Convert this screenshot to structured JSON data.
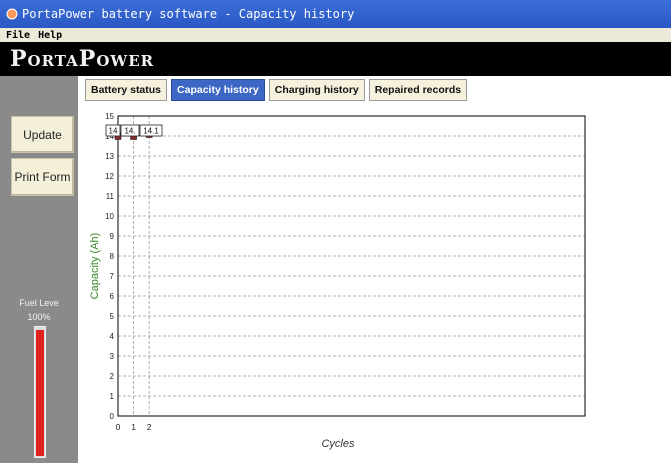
{
  "window": {
    "title": "PortaPower battery software - Capacity history"
  },
  "menu": [
    {
      "label": "File"
    },
    {
      "label": "Help"
    }
  ],
  "brand": {
    "logo_text": "PortaPower"
  },
  "sidebar": {
    "buttons": [
      {
        "label": "Update"
      },
      {
        "label": "Print Form"
      }
    ],
    "fuel_label": "Fuel Leve",
    "fuel_percent_label": "100%",
    "fuel_level": 1.0,
    "fuel_color": "#e2221e"
  },
  "tabs": [
    {
      "label": "Battery status",
      "active": false
    },
    {
      "label": "Capacity history",
      "active": true
    },
    {
      "label": "Charging history",
      "active": false
    },
    {
      "label": "Repaired records",
      "active": false
    }
  ],
  "colors": {
    "accent": "#3d67c4",
    "axis_label": "#3a8a2a",
    "marker": "#8b2a2a"
  },
  "chart_data": {
    "type": "line",
    "x": [
      0,
      1,
      2
    ],
    "y": [
      14,
      14,
      14.1
    ],
    "data_labels": [
      "14",
      "14.",
      "14.1"
    ],
    "xlabel": "Cycles",
    "ylabel": "Capacity (Ah)",
    "xlim": [
      0,
      30
    ],
    "ylim": [
      0,
      15
    ],
    "yticks": [
      0,
      1,
      2,
      3,
      4,
      5,
      6,
      7,
      8,
      9,
      10,
      11,
      12,
      13,
      14,
      15
    ],
    "xticks": [
      0,
      1,
      2
    ],
    "grid": true
  }
}
